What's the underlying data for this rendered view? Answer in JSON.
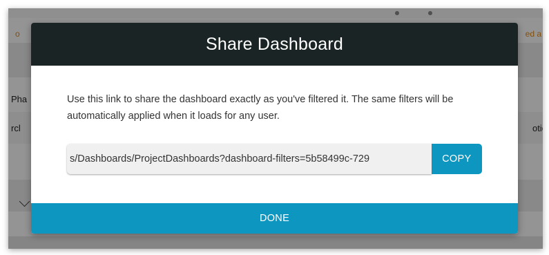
{
  "background": {
    "left_notice_fragment": "o",
    "right_notice_fragment": "ed a",
    "left_label_1": "Pha",
    "left_label_2": "rcl",
    "right_label_2": "otio"
  },
  "modal": {
    "title": "Share Dashboard",
    "description": "Use this link to share the dashboard exactly as you've filtered it. The same filters will be automatically applied when it loads for any user.",
    "link_value": "⁦s/Dashboards/ProjectDashboards?dashboard-filters=5b58499c-729⁩",
    "copy_label": "COPY",
    "done_label": "DONE"
  },
  "colors": {
    "header_bg": "#1a2424",
    "accent": "#0d96c0",
    "notice": "#e08a1a"
  }
}
